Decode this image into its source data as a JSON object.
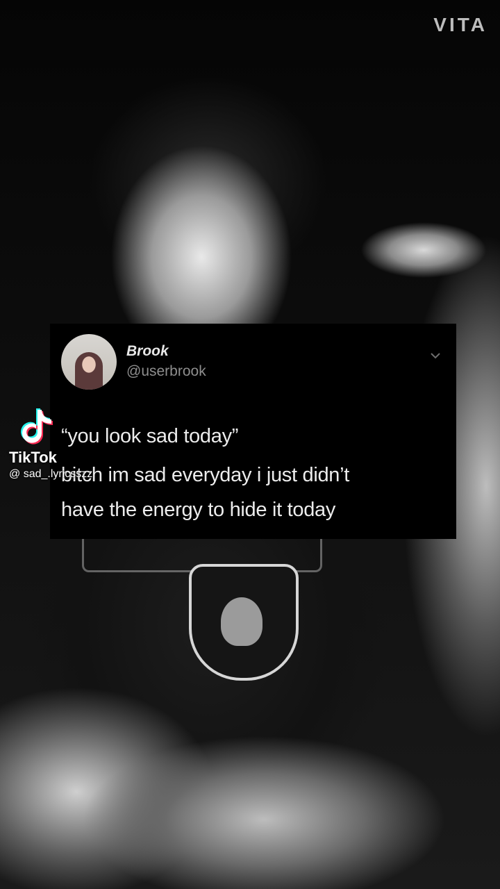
{
  "watermark": "VITA",
  "tweet": {
    "author_name": "Brook",
    "author_handle": "@userbrook",
    "line1": "“you look sad today”",
    "line2": "bitch im sad everyday i just didn’t",
    "line3": "have the energy to hide it today"
  },
  "tiktok": {
    "brand": "TikTok",
    "username": "@ sad_.lyricsszz"
  },
  "icons": {
    "chevron": "chevron-down-icon",
    "tiktok_logo": "tiktok-logo-icon"
  }
}
